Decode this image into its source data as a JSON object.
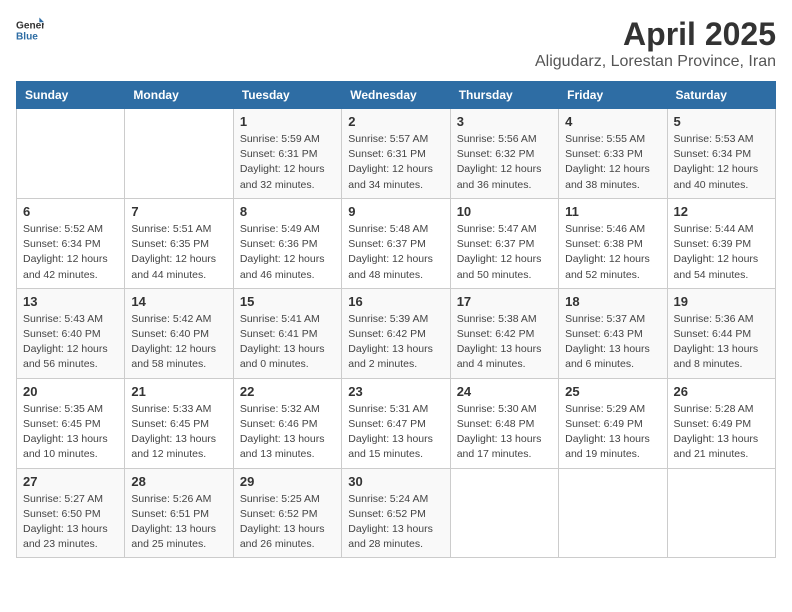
{
  "logo": {
    "text_general": "General",
    "text_blue": "Blue"
  },
  "title": "April 2025",
  "subtitle": "Aligudarz, Lorestan Province, Iran",
  "days_of_week": [
    "Sunday",
    "Monday",
    "Tuesday",
    "Wednesday",
    "Thursday",
    "Friday",
    "Saturday"
  ],
  "weeks": [
    [
      null,
      null,
      {
        "day": "1",
        "sunrise": "Sunrise: 5:59 AM",
        "sunset": "Sunset: 6:31 PM",
        "daylight": "Daylight: 12 hours and 32 minutes."
      },
      {
        "day": "2",
        "sunrise": "Sunrise: 5:57 AM",
        "sunset": "Sunset: 6:31 PM",
        "daylight": "Daylight: 12 hours and 34 minutes."
      },
      {
        "day": "3",
        "sunrise": "Sunrise: 5:56 AM",
        "sunset": "Sunset: 6:32 PM",
        "daylight": "Daylight: 12 hours and 36 minutes."
      },
      {
        "day": "4",
        "sunrise": "Sunrise: 5:55 AM",
        "sunset": "Sunset: 6:33 PM",
        "daylight": "Daylight: 12 hours and 38 minutes."
      },
      {
        "day": "5",
        "sunrise": "Sunrise: 5:53 AM",
        "sunset": "Sunset: 6:34 PM",
        "daylight": "Daylight: 12 hours and 40 minutes."
      }
    ],
    [
      {
        "day": "6",
        "sunrise": "Sunrise: 5:52 AM",
        "sunset": "Sunset: 6:34 PM",
        "daylight": "Daylight: 12 hours and 42 minutes."
      },
      {
        "day": "7",
        "sunrise": "Sunrise: 5:51 AM",
        "sunset": "Sunset: 6:35 PM",
        "daylight": "Daylight: 12 hours and 44 minutes."
      },
      {
        "day": "8",
        "sunrise": "Sunrise: 5:49 AM",
        "sunset": "Sunset: 6:36 PM",
        "daylight": "Daylight: 12 hours and 46 minutes."
      },
      {
        "day": "9",
        "sunrise": "Sunrise: 5:48 AM",
        "sunset": "Sunset: 6:37 PM",
        "daylight": "Daylight: 12 hours and 48 minutes."
      },
      {
        "day": "10",
        "sunrise": "Sunrise: 5:47 AM",
        "sunset": "Sunset: 6:37 PM",
        "daylight": "Daylight: 12 hours and 50 minutes."
      },
      {
        "day": "11",
        "sunrise": "Sunrise: 5:46 AM",
        "sunset": "Sunset: 6:38 PM",
        "daylight": "Daylight: 12 hours and 52 minutes."
      },
      {
        "day": "12",
        "sunrise": "Sunrise: 5:44 AM",
        "sunset": "Sunset: 6:39 PM",
        "daylight": "Daylight: 12 hours and 54 minutes."
      }
    ],
    [
      {
        "day": "13",
        "sunrise": "Sunrise: 5:43 AM",
        "sunset": "Sunset: 6:40 PM",
        "daylight": "Daylight: 12 hours and 56 minutes."
      },
      {
        "day": "14",
        "sunrise": "Sunrise: 5:42 AM",
        "sunset": "Sunset: 6:40 PM",
        "daylight": "Daylight: 12 hours and 58 minutes."
      },
      {
        "day": "15",
        "sunrise": "Sunrise: 5:41 AM",
        "sunset": "Sunset: 6:41 PM",
        "daylight": "Daylight: 13 hours and 0 minutes."
      },
      {
        "day": "16",
        "sunrise": "Sunrise: 5:39 AM",
        "sunset": "Sunset: 6:42 PM",
        "daylight": "Daylight: 13 hours and 2 minutes."
      },
      {
        "day": "17",
        "sunrise": "Sunrise: 5:38 AM",
        "sunset": "Sunset: 6:42 PM",
        "daylight": "Daylight: 13 hours and 4 minutes."
      },
      {
        "day": "18",
        "sunrise": "Sunrise: 5:37 AM",
        "sunset": "Sunset: 6:43 PM",
        "daylight": "Daylight: 13 hours and 6 minutes."
      },
      {
        "day": "19",
        "sunrise": "Sunrise: 5:36 AM",
        "sunset": "Sunset: 6:44 PM",
        "daylight": "Daylight: 13 hours and 8 minutes."
      }
    ],
    [
      {
        "day": "20",
        "sunrise": "Sunrise: 5:35 AM",
        "sunset": "Sunset: 6:45 PM",
        "daylight": "Daylight: 13 hours and 10 minutes."
      },
      {
        "day": "21",
        "sunrise": "Sunrise: 5:33 AM",
        "sunset": "Sunset: 6:45 PM",
        "daylight": "Daylight: 13 hours and 12 minutes."
      },
      {
        "day": "22",
        "sunrise": "Sunrise: 5:32 AM",
        "sunset": "Sunset: 6:46 PM",
        "daylight": "Daylight: 13 hours and 13 minutes."
      },
      {
        "day": "23",
        "sunrise": "Sunrise: 5:31 AM",
        "sunset": "Sunset: 6:47 PM",
        "daylight": "Daylight: 13 hours and 15 minutes."
      },
      {
        "day": "24",
        "sunrise": "Sunrise: 5:30 AM",
        "sunset": "Sunset: 6:48 PM",
        "daylight": "Daylight: 13 hours and 17 minutes."
      },
      {
        "day": "25",
        "sunrise": "Sunrise: 5:29 AM",
        "sunset": "Sunset: 6:49 PM",
        "daylight": "Daylight: 13 hours and 19 minutes."
      },
      {
        "day": "26",
        "sunrise": "Sunrise: 5:28 AM",
        "sunset": "Sunset: 6:49 PM",
        "daylight": "Daylight: 13 hours and 21 minutes."
      }
    ],
    [
      {
        "day": "27",
        "sunrise": "Sunrise: 5:27 AM",
        "sunset": "Sunset: 6:50 PM",
        "daylight": "Daylight: 13 hours and 23 minutes."
      },
      {
        "day": "28",
        "sunrise": "Sunrise: 5:26 AM",
        "sunset": "Sunset: 6:51 PM",
        "daylight": "Daylight: 13 hours and 25 minutes."
      },
      {
        "day": "29",
        "sunrise": "Sunrise: 5:25 AM",
        "sunset": "Sunset: 6:52 PM",
        "daylight": "Daylight: 13 hours and 26 minutes."
      },
      {
        "day": "30",
        "sunrise": "Sunrise: 5:24 AM",
        "sunset": "Sunset: 6:52 PM",
        "daylight": "Daylight: 13 hours and 28 minutes."
      },
      null,
      null,
      null
    ]
  ]
}
